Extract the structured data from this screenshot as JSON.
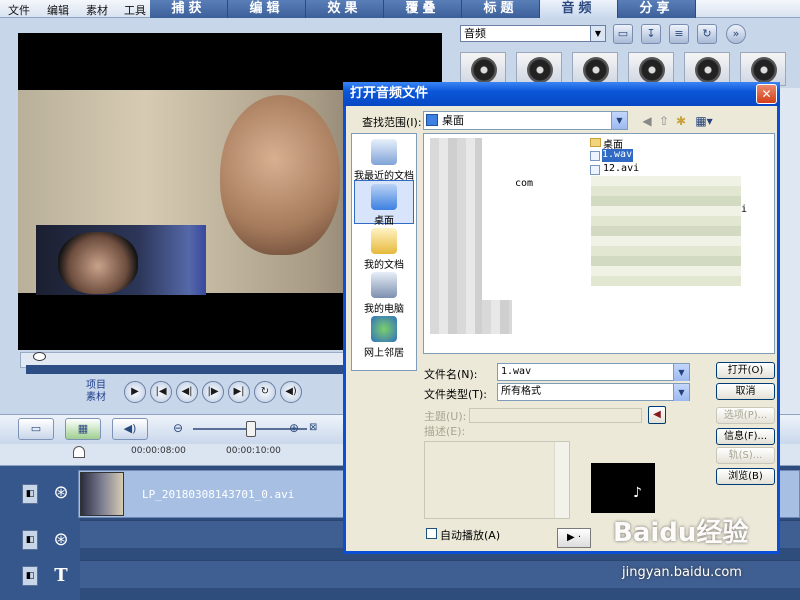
{
  "menu": {
    "file": "文件",
    "edit": "编辑",
    "clip": "素材",
    "tools": "工具"
  },
  "tabs": [
    {
      "label": "捕获"
    },
    {
      "label": "编辑"
    },
    {
      "label": "效果"
    },
    {
      "label": "覆叠"
    },
    {
      "label": "标题"
    },
    {
      "label": "音频",
      "active": true
    },
    {
      "label": "分享"
    }
  ],
  "library": {
    "category": "音频",
    "thumbnail_count": 6
  },
  "player": {
    "project_label": "项目",
    "clip_label": "素材"
  },
  "timeline": {
    "ticks": [
      "00:00:08:00",
      "00:00:10:00"
    ],
    "clip_name": "LP_20180308143701_0.avi"
  },
  "dialog": {
    "title": "打开音频文件",
    "look_in_label": "查找范围(I):",
    "look_in_value": "桌面",
    "places": [
      "我最近的文档",
      "桌面",
      "我的文档",
      "我的电脑",
      "网上邻居"
    ],
    "files": {
      "folder": "桌面",
      "selected": "1.wav",
      "next": "12.avi",
      "partial_com": "com",
      "partial_i": "i"
    },
    "filename_label": "文件名(N):",
    "filename_value": "1.wav",
    "filetype_label": "文件类型(T):",
    "filetype_value": "所有格式",
    "subject_label": "主题(U):",
    "desc_label": "描述(E):",
    "buttons": {
      "open": "打开(O)",
      "cancel": "取消",
      "options": "选项(P)...",
      "info": "信息(F)...",
      "compose": "轨(S)...",
      "browse": "浏览(B)"
    },
    "autoplay_label": "自动播放(A)",
    "play_label": "▶ ·"
  },
  "watermark": {
    "brand": "Baidu经验",
    "url": "jingyan.baidu.com"
  },
  "colors": {
    "title_bar": "#0a56d8",
    "tab_bar": "#3c5f99",
    "timeline": "#2e4c7c",
    "selection": "#316ac5"
  }
}
